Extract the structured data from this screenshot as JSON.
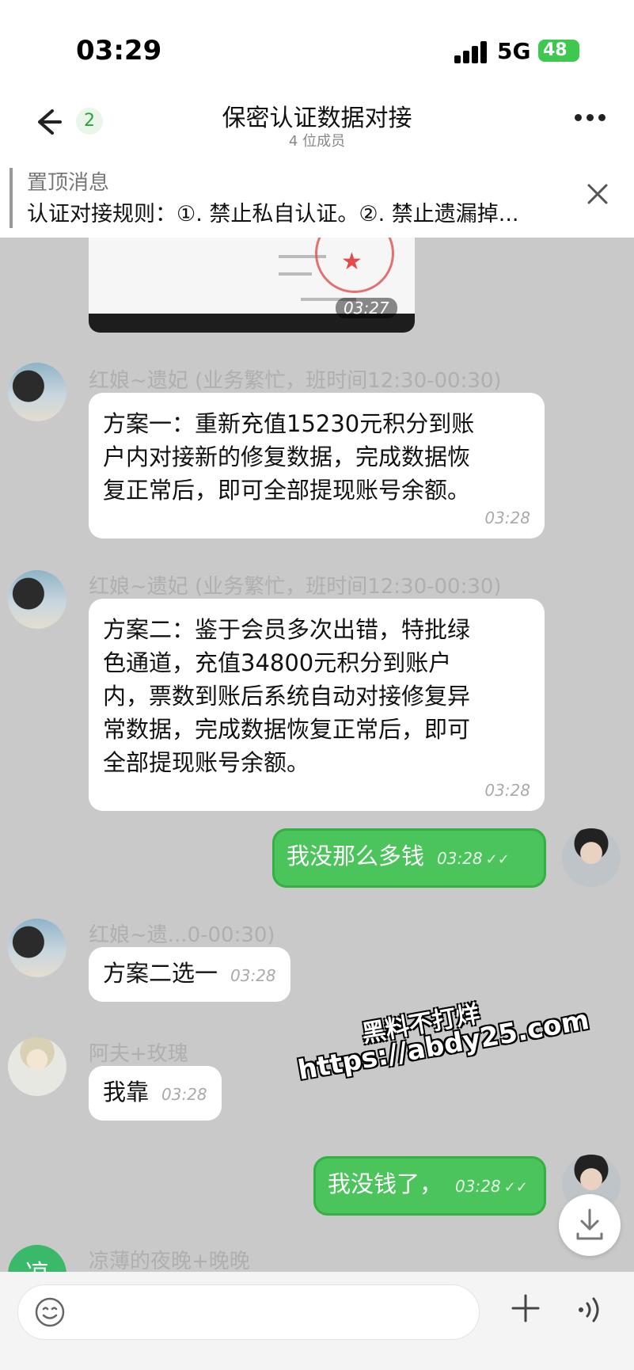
{
  "status": {
    "time": "03:29",
    "network": "5G",
    "battery": "48"
  },
  "header": {
    "back_badge": "2",
    "title": "保密认证数据对接",
    "subtitle": "4 位成员"
  },
  "pinned": {
    "title": "置顶消息",
    "text": "认证对接规则：①. 禁止私自认证。②. 禁止遗漏掉..."
  },
  "messages": [
    {
      "type": "image",
      "time": "03:27"
    },
    {
      "sender": "红娘~遗妃 (业务繁忙，班时间12:30-00:30)",
      "lines": [
        "方案一：重新充值15230元积分到账",
        "户内对接新的修复数据，完成数据恢",
        "复正常后，即可全部提现账号余额。"
      ],
      "time": "03:28"
    },
    {
      "sender": "红娘~遗妃 (业务繁忙，班时间12:30-00:30)",
      "lines": [
        "方案二：鉴于会员多次出错，特批绿",
        "色通道，充值34800元积分到账户",
        "内，票数到账后系统自动对接修复异",
        "常数据，完成数据恢复正常后，即可",
        "全部提现账号余额。"
      ],
      "time": "03:28"
    },
    {
      "outgoing": true,
      "text": "我没那么多钱",
      "time": "03:28"
    },
    {
      "sender": "红娘~遗...0-00:30)",
      "text": "方案二选一",
      "time": "03:28"
    },
    {
      "sender": "阿夫+玫瑰",
      "text": "我靠",
      "time": "03:28"
    },
    {
      "outgoing": true,
      "text": "我没钱了，",
      "time": "03:28"
    },
    {
      "sender": "凉薄的夜晚+晚晚",
      "avatar_text": "凉"
    }
  ],
  "watermark": {
    "line1": "黑料不打烊",
    "line2": "https://abdy25.com"
  },
  "icons": {
    "back": "arrow-left-icon",
    "more": "more-dots-icon",
    "close": "close-icon",
    "emoji": "emoji-icon",
    "plus": "plus-icon",
    "voice": "voice-icon",
    "scroll": "download-arrow-icon"
  },
  "colors": {
    "outgoing_bubble": "#4cc45c",
    "incoming_bubble": "#ffffff",
    "chat_bg": "#c9c9c9"
  }
}
